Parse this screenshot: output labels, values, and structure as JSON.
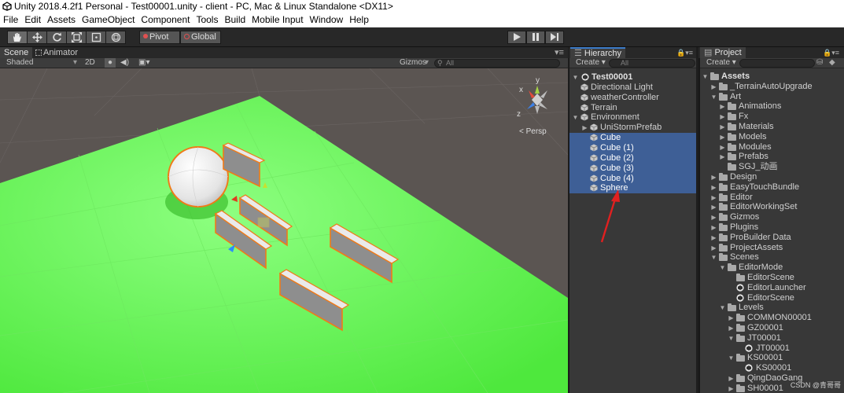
{
  "window": {
    "title": "Unity 2018.4.2f1 Personal - Test00001.unity - client - PC, Mac & Linux Standalone <DX11>"
  },
  "menu": [
    "File",
    "Edit",
    "Assets",
    "GameObject",
    "Component",
    "Tools",
    "Build",
    "Mobile Input",
    "Window",
    "Help"
  ],
  "toolbar": {
    "pivot": "Pivot",
    "global": "Global"
  },
  "scene": {
    "tab_scene": "Scene",
    "tab_animator": "Animator",
    "shaded": "Shaded",
    "mode_2d": "2D",
    "gizmos": "Gizmos",
    "search_placeholder": "All",
    "gizmo_persp": "< Persp",
    "axis_x": "x",
    "axis_y": "y",
    "axis_z": "z"
  },
  "hierarchy": {
    "tab": "Hierarchy",
    "create": "Create",
    "search_placeholder": "All",
    "scene_name": "Test00001",
    "items": [
      {
        "label": "Directional Light",
        "level": 1,
        "selected": false
      },
      {
        "label": "weatherController",
        "level": 1,
        "selected": false
      },
      {
        "label": "Terrain",
        "level": 1,
        "selected": false
      },
      {
        "label": "Environment",
        "level": 1,
        "selected": false,
        "expanded": true
      },
      {
        "label": "UniStormPrefab",
        "level": 2,
        "selected": false,
        "collapsed": true
      },
      {
        "label": "Cube",
        "level": 2,
        "selected": true
      },
      {
        "label": "Cube (1)",
        "level": 2,
        "selected": true
      },
      {
        "label": "Cube (2)",
        "level": 2,
        "selected": true
      },
      {
        "label": "Cube (3)",
        "level": 2,
        "selected": true
      },
      {
        "label": "Cube (4)",
        "level": 2,
        "selected": true
      },
      {
        "label": "Sphere",
        "level": 2,
        "selected": true
      }
    ]
  },
  "project": {
    "tab": "Project",
    "create": "Create",
    "root": "Assets",
    "items": [
      {
        "label": "_TerrainAutoUpgrade",
        "level": 1,
        "type": "folder",
        "arrow": "right"
      },
      {
        "label": "Art",
        "level": 1,
        "type": "folder",
        "arrow": "down"
      },
      {
        "label": "Animations",
        "level": 2,
        "type": "folder",
        "arrow": "right"
      },
      {
        "label": "Fx",
        "level": 2,
        "type": "folder",
        "arrow": "right"
      },
      {
        "label": "Materials",
        "level": 2,
        "type": "folder",
        "arrow": "right"
      },
      {
        "label": "Models",
        "level": 2,
        "type": "folder",
        "arrow": "right"
      },
      {
        "label": "Modules",
        "level": 2,
        "type": "folder",
        "arrow": "right"
      },
      {
        "label": "Prefabs",
        "level": 2,
        "type": "folder",
        "arrow": "right"
      },
      {
        "label": "SGJ_动画",
        "level": 2,
        "type": "folder",
        "arrow": "none"
      },
      {
        "label": "Design",
        "level": 1,
        "type": "folder",
        "arrow": "right"
      },
      {
        "label": "EasyTouchBundle",
        "level": 1,
        "type": "folder",
        "arrow": "right"
      },
      {
        "label": "Editor",
        "level": 1,
        "type": "folder",
        "arrow": "right"
      },
      {
        "label": "EditorWorkingSet",
        "level": 1,
        "type": "folder",
        "arrow": "right"
      },
      {
        "label": "Gizmos",
        "level": 1,
        "type": "folder",
        "arrow": "right"
      },
      {
        "label": "Plugins",
        "level": 1,
        "type": "folder",
        "arrow": "right"
      },
      {
        "label": "ProBuilder Data",
        "level": 1,
        "type": "folder",
        "arrow": "right"
      },
      {
        "label": "ProjectAssets",
        "level": 1,
        "type": "folder",
        "arrow": "right"
      },
      {
        "label": "Scenes",
        "level": 1,
        "type": "folder",
        "arrow": "down"
      },
      {
        "label": "EditorMode",
        "level": 2,
        "type": "folder",
        "arrow": "down"
      },
      {
        "label": "EditorScene",
        "level": 3,
        "type": "folder",
        "arrow": "none"
      },
      {
        "label": "EditorLauncher",
        "level": 3,
        "type": "unity",
        "arrow": "none"
      },
      {
        "label": "EditorScene",
        "level": 3,
        "type": "unity",
        "arrow": "none"
      },
      {
        "label": "Levels",
        "level": 2,
        "type": "folder",
        "arrow": "down"
      },
      {
        "label": "COMMON00001",
        "level": 3,
        "type": "folder",
        "arrow": "right"
      },
      {
        "label": "GZ00001",
        "level": 3,
        "type": "folder",
        "arrow": "right"
      },
      {
        "label": "JT00001",
        "level": 3,
        "type": "folder",
        "arrow": "down"
      },
      {
        "label": "JT00001",
        "level": 4,
        "type": "unity",
        "arrow": "none"
      },
      {
        "label": "KS00001",
        "level": 3,
        "type": "folder",
        "arrow": "down"
      },
      {
        "label": "KS00001",
        "level": 4,
        "type": "unity",
        "arrow": "none"
      },
      {
        "label": "QingDaoGang",
        "level": 3,
        "type": "folder",
        "arrow": "right"
      },
      {
        "label": "SH00001",
        "level": 3,
        "type": "folder",
        "arrow": "right"
      }
    ]
  },
  "watermark": "CSDN @青哥哥",
  "colors": {
    "selection": "#3e5f96",
    "ground": "#55e84a",
    "annotation_arrow": "#e02020"
  }
}
